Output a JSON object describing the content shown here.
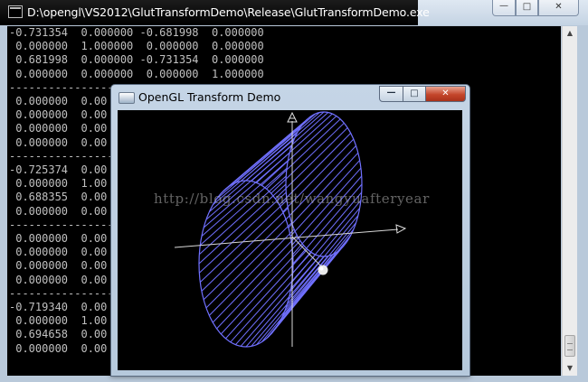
{
  "console": {
    "title": "D:\\opengl\\VS2012\\GlutTransformDemo\\Release\\GlutTransformDemo.exe",
    "controls": {
      "minimize": "—",
      "maximize": "□",
      "close": "✕"
    },
    "lines": [
      "-0.731354  0.000000 -0.681998  0.000000",
      " 0.000000  1.000000  0.000000  0.000000",
      " 0.681998  0.000000 -0.731354  0.000000",
      " 0.000000  0.000000  0.000000  1.000000",
      "-------------------------------------------",
      " 0.000000  0.00",
      " 0.000000  0.00",
      " 0.000000  0.00",
      " 0.000000  0.00",
      "-------------------------------------------",
      "-0.725374  0.00",
      " 0.000000  1.00",
      " 0.688355  0.00",
      " 0.000000  0.00",
      "-------------------------------------------",
      " 0.000000  0.00",
      " 0.000000  0.00",
      " 0.000000  0.00",
      " 0.000000  0.00",
      "-------------------------------------------",
      "-0.719340  0.00",
      " 0.000000  1.00",
      " 0.694658  0.00",
      " 0.000000  0.00"
    ]
  },
  "gl_window": {
    "title": "OpenGL Transform Demo",
    "controls": {
      "minimize": "—",
      "maximize": "□",
      "close": "✕"
    },
    "wire_color": "#7070ff"
  },
  "watermark": "http://blog.csdn.net/wangyuafteryear"
}
